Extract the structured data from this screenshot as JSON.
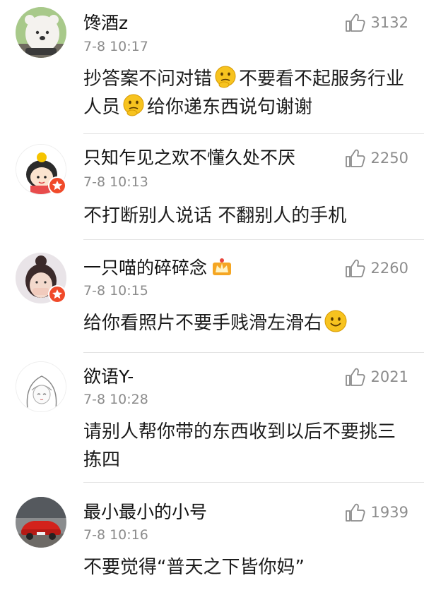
{
  "comments": [
    {
      "name": "馋酒z",
      "time": "7-8 10:17",
      "likes": "3132",
      "text_a": "抄答案不问对错",
      "text_b": "不要看不起服务行业人员",
      "text_c": "给你递东西说句谢谢"
    },
    {
      "name": "只知乍见之欢不懂久处不厌",
      "time": "7-8 10:13",
      "likes": "2250",
      "text": "不打断别人说话 不翻别人的手机"
    },
    {
      "name": "一只喵的碎碎念",
      "time": "7-8 10:15",
      "likes": "2260",
      "text": "给你看照片不要手贱滑左滑右"
    },
    {
      "name": "欲语Y-",
      "time": "7-8 10:28",
      "likes": "2021",
      "text": "请别人帮你带的东西收到以后不要挑三拣四"
    },
    {
      "name": "最小最小的小号",
      "time": "7-8 10:16",
      "likes": "1939",
      "text": "不要觉得“普天之下皆你妈”"
    }
  ],
  "icons": {
    "like": "thumbs-up-icon",
    "verified": "verified-badge-icon",
    "emoji_thinking": "thinking-emoji-icon",
    "emoji_smile": "smile-emoji-icon",
    "vip": "crown-vip-icon"
  },
  "colors": {
    "text": "#1d1d1d",
    "meta": "#8c8c8c",
    "divider": "#e3e3e3",
    "verified": "#f04a2a",
    "emoji": "#f7c31f"
  }
}
